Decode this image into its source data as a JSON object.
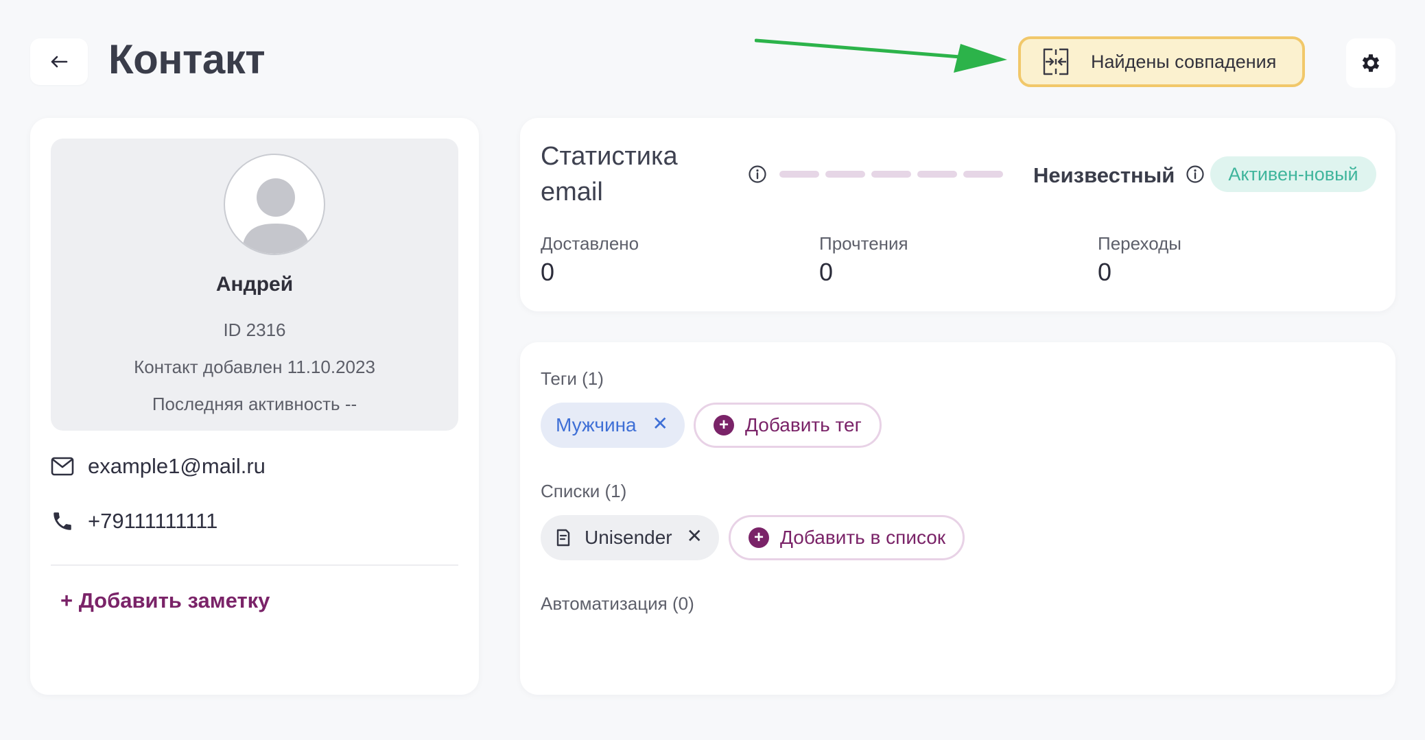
{
  "header": {
    "title": "Контакт",
    "back_icon": "arrow-left-icon",
    "matches_label": "Найдены совпадения",
    "matches_icon": "merge-icon",
    "settings_icon": "gear-icon"
  },
  "profile": {
    "name": "Андрей",
    "id": "ID 2316",
    "added": "Контакт добавлен 11.10.2023",
    "last_activity": "Последняя активность --",
    "email": "example1@mail.ru",
    "phone": "+79111111111",
    "add_note_label": "+ Добавить заметку"
  },
  "stats": {
    "title_line1": "Статистика",
    "title_line2": "email",
    "status_word": "Неизвестный",
    "status_badge": "Активен-новый",
    "metrics": [
      {
        "label": "Доставлено",
        "value": "0"
      },
      {
        "label": "Прочтения",
        "value": "0"
      },
      {
        "label": "Переходы",
        "value": "0"
      }
    ]
  },
  "tags": {
    "label": "Теги (1)",
    "items": [
      "Мужчина"
    ],
    "add_label": "Добавить тег"
  },
  "lists": {
    "label": "Списки (1)",
    "items": [
      "Unisender"
    ],
    "add_label": "Добавить в список"
  },
  "automation": {
    "label": "Автоматизация (0)"
  },
  "colors": {
    "brand_purple": "#7a2368",
    "matches_bg": "#fbf1cf",
    "matches_border": "#f1c86a",
    "status_badge_bg": "#dff4ef",
    "status_badge_text": "#3fb59c",
    "tag_chip_text": "#3e6fd6",
    "annotation_arrow": "#2cb34a"
  }
}
